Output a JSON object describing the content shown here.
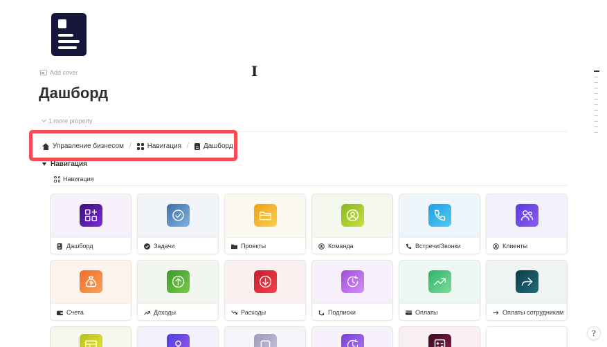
{
  "page": {
    "add_cover_label": "Add cover",
    "title": "Дашборд",
    "more_property_label": "1 more property",
    "help_label": "?"
  },
  "breadcrumb": {
    "items": [
      {
        "icon": "home-icon",
        "label": "Управление бизнесом"
      },
      {
        "icon": "grid-icon",
        "label": "Навигация"
      },
      {
        "icon": "document-icon",
        "label": "Дашборд"
      }
    ],
    "separator": "/"
  },
  "toggle": {
    "label": "Навигация"
  },
  "view": {
    "label": "Навигация",
    "icon": "gallery-icon"
  },
  "colors": {
    "accent_highlight": "#f24b53",
    "text": "#37352f",
    "muted": "#a5a29b"
  },
  "cards": [
    {
      "label": "Дашборд",
      "icon": "dashboard-icon",
      "grad": [
        "#3a0f7a",
        "#7a2bd8"
      ],
      "bg": "#f7f1fb"
    },
    {
      "label": "Задачи",
      "icon": "check-icon",
      "grad": [
        "#3f6fa8",
        "#7fb2e0"
      ],
      "bg": "#f1f5f9"
    },
    {
      "label": "Проекты",
      "icon": "folder-icon",
      "grad": [
        "#f0a01a",
        "#f9d049"
      ],
      "bg": "#faf8ef"
    },
    {
      "label": "Команда",
      "icon": "user-icon",
      "grad": [
        "#8ab820",
        "#c9df3f"
      ],
      "bg": "#f5f8ee"
    },
    {
      "label": "Встречи/Звонки",
      "icon": "phone-icon",
      "grad": [
        "#1ea0e8",
        "#54c8ee"
      ],
      "bg": "#eef6fb"
    },
    {
      "label": "Клиенты",
      "icon": "users-icon",
      "grad": [
        "#5b3be0",
        "#8a5cf0"
      ],
      "bg": "#f3f1fb"
    },
    {
      "label": "Счета",
      "icon": "money-bag-icon",
      "grad": [
        "#f06c2a",
        "#f9a35a"
      ],
      "bg": "#fbf3ec"
    },
    {
      "label": "Доходы",
      "icon": "arrow-up-icon",
      "grad": [
        "#3f9a2b",
        "#7ac94a"
      ],
      "bg": "#f1f7ee"
    },
    {
      "label": "Расходы",
      "icon": "arrow-down-icon",
      "grad": [
        "#c81e2e",
        "#f0424a"
      ],
      "bg": "#fbf0f0"
    },
    {
      "label": "Подписки",
      "icon": "clock-icon",
      "grad": [
        "#a24be0",
        "#d392f2"
      ],
      "bg": "#f8f1fb"
    },
    {
      "label": "Оплаты",
      "icon": "trend-up-icon",
      "grad": [
        "#2fb36a",
        "#7ddc99"
      ],
      "bg": "#eef8f2"
    },
    {
      "label": "Оплаты сотрудникам",
      "icon": "forward-icon",
      "grad": [
        "#0f3a4a",
        "#1f6e7a"
      ],
      "bg": "#eef3f4"
    },
    {
      "label": "",
      "icon": "window-icon",
      "grad": [
        "#b8c020",
        "#e6e83a"
      ],
      "bg": "#f6f8ee"
    },
    {
      "label": "",
      "icon": "person-icon",
      "grad": [
        "#4a3de0",
        "#a05cf0"
      ],
      "bg": "#f3f1fb"
    },
    {
      "label": "",
      "icon": "square-icon",
      "grad": [
        "#a09ab8",
        "#c7c3dc"
      ],
      "bg": "#f7f4fb"
    },
    {
      "label": "",
      "icon": "clock-icon",
      "grad": [
        "#7a3dd8",
        "#b07af0"
      ],
      "bg": "#f6f1fb"
    },
    {
      "label": "",
      "icon": "calculator-icon",
      "grad": [
        "#3a0a22",
        "#8a1e4e"
      ],
      "bg": "#f8f0f3"
    },
    {
      "label": "",
      "icon": "",
      "grad": [
        "#ffffff",
        "#ffffff"
      ],
      "bg": "#ffffff"
    }
  ]
}
